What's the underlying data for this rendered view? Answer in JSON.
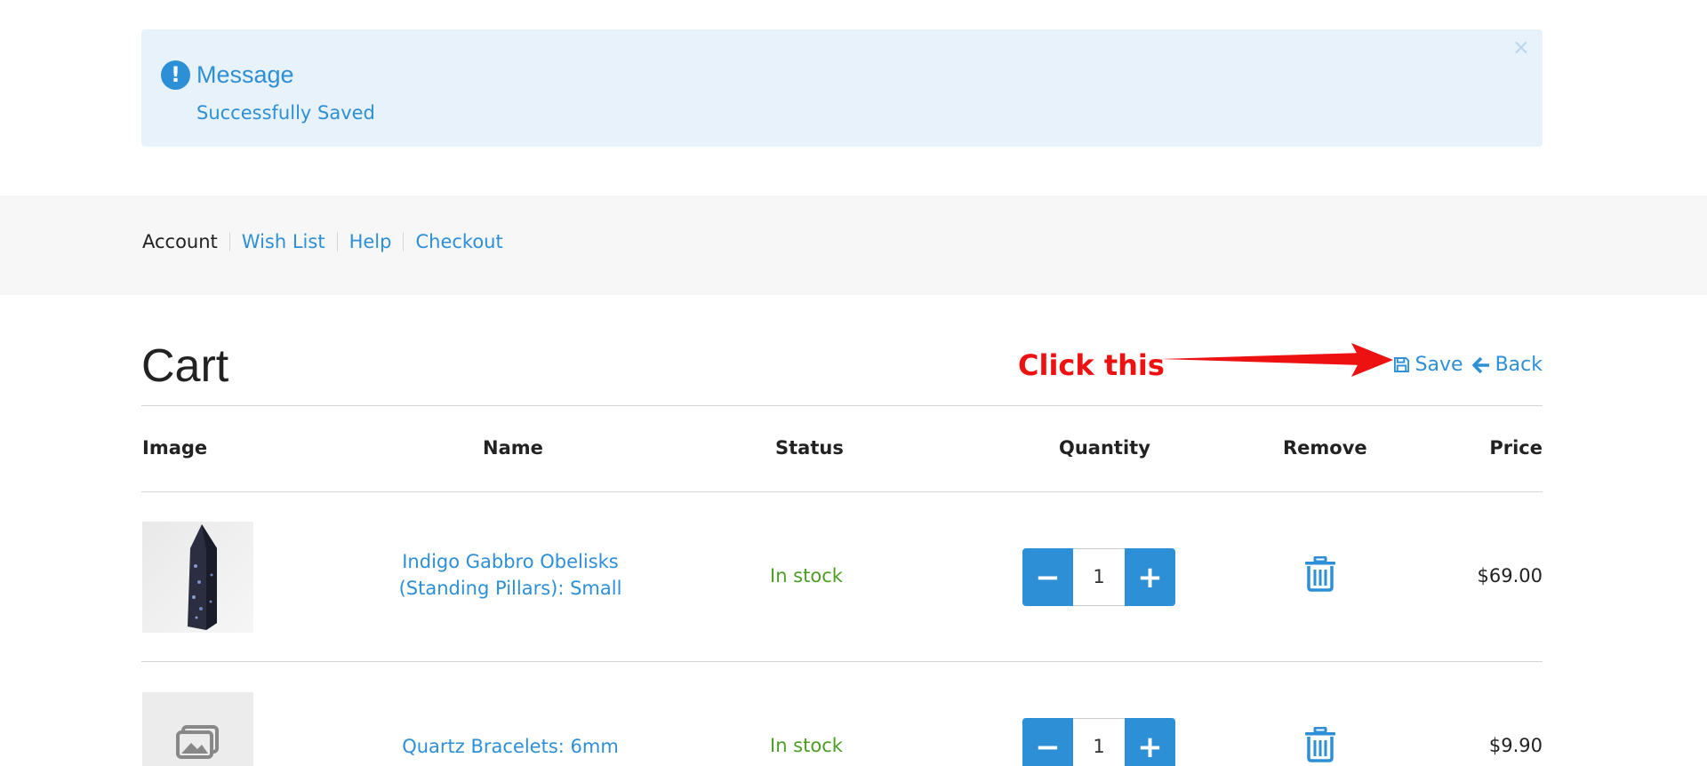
{
  "alert": {
    "title": "Message",
    "text": "Successfully Saved",
    "close": "×",
    "icon": "exclamation-circle-icon"
  },
  "nav": {
    "items": [
      {
        "label": "Account"
      },
      {
        "label": "Wish List"
      },
      {
        "label": "Help"
      },
      {
        "label": "Checkout"
      }
    ]
  },
  "page": {
    "title": "Cart",
    "annotation": "Click this",
    "save_label": "Save",
    "back_label": "Back"
  },
  "table": {
    "headers": [
      "Image",
      "Name",
      "Status",
      "Quantity",
      "Remove",
      "Price"
    ],
    "rows": [
      {
        "name_line1": "Indigo Gabbro Obelisks",
        "name_line2": "(Standing Pillars): Small",
        "status": "In stock",
        "quantity": "1",
        "price": "$69.00"
      },
      {
        "name_line1": "Quartz Bracelets: 6mm",
        "status": "In stock",
        "quantity": "1",
        "price": "$9.90"
      }
    ]
  },
  "colors": {
    "accent": "#2d8fd6",
    "alert_bg": "#e8f2fb",
    "in_stock": "#4a9e23",
    "annotation": "#ee1111"
  }
}
